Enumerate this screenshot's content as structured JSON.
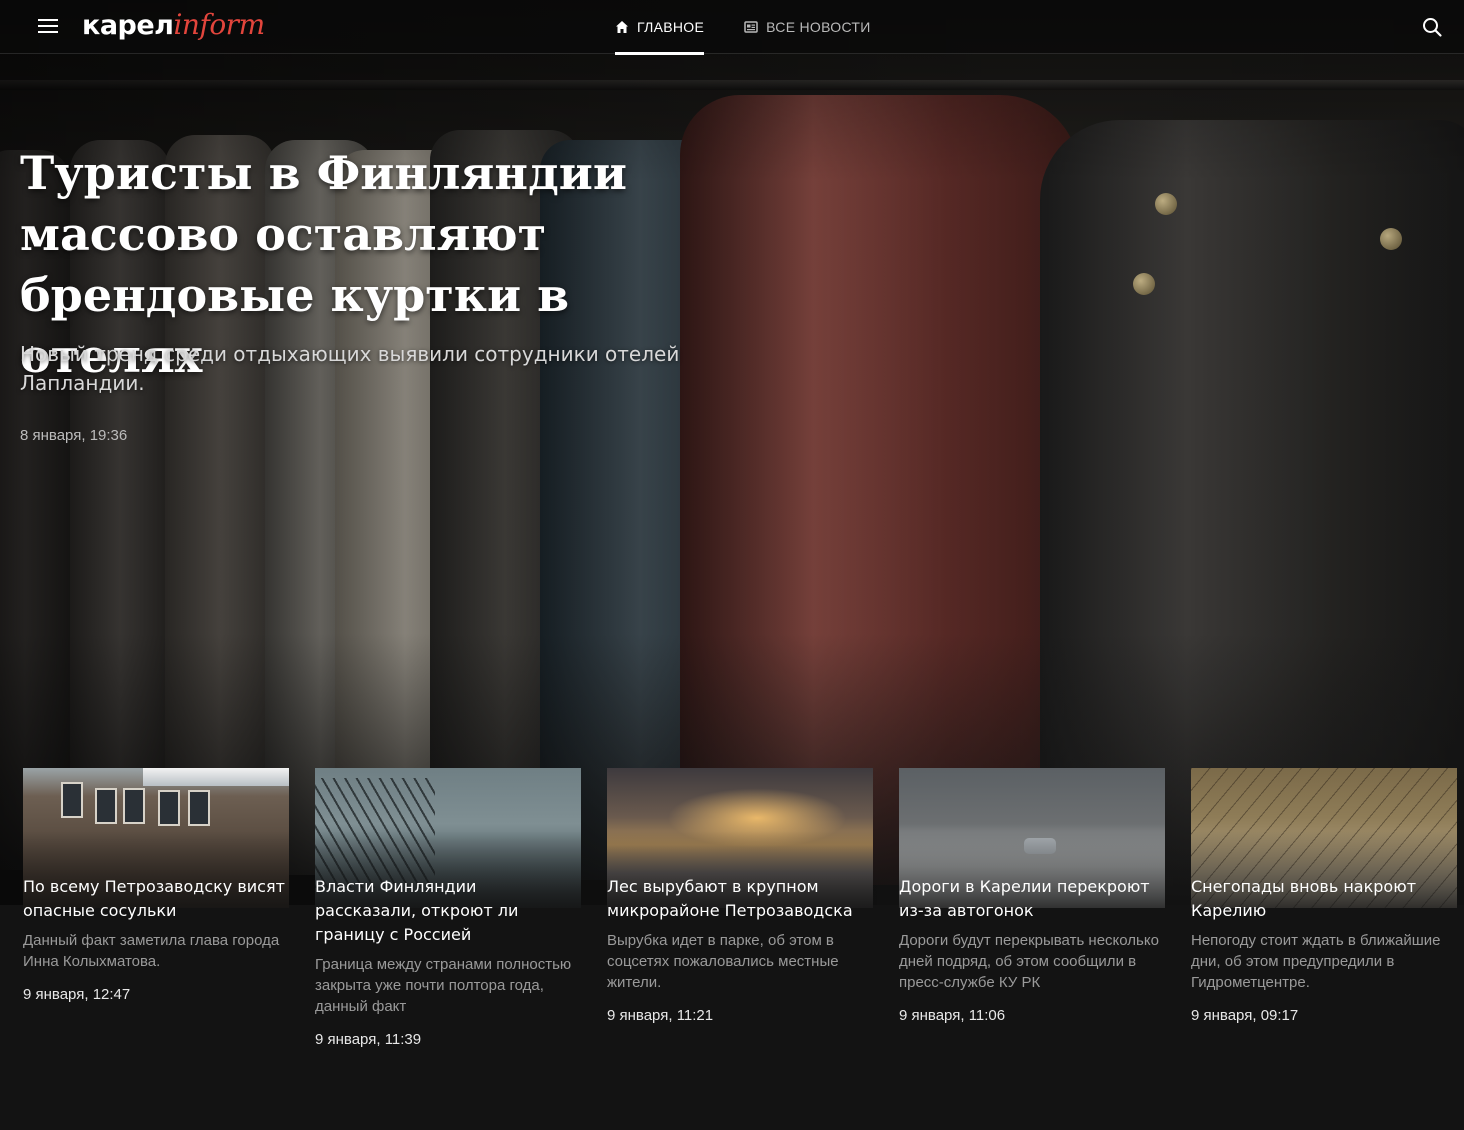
{
  "header": {
    "logo_part1": "карел",
    "logo_part2": "inform",
    "nav": [
      {
        "label": "ГЛАВНОЕ",
        "icon": "home-icon",
        "active": true
      },
      {
        "label": "ВСЕ НОВОСТИ",
        "icon": "newspaper-icon",
        "active": false
      }
    ],
    "menu_icon": "hamburger-menu-icon",
    "search_icon": "search-icon"
  },
  "hero": {
    "title": "Туристы в Финляндии массово оставляют брендовые куртки в отелях",
    "lead": "Новый тренд среди отдыхающих выявили сотрудники отелей Лапландии.",
    "date": "8 января, 19:36"
  },
  "cards": [
    {
      "title": "По всему Петрозаводску висят опасные сосульки",
      "lead": "Данный факт заметила глава города Инна Колыхматова.",
      "date": "9 января, 12:47"
    },
    {
      "title": "Власти Финляндии рассказали, откроют ли границу с Россией",
      "lead": "Граница между странами полностью закрыта уже почти полтора года, данный факт",
      "date": "9 января, 11:39"
    },
    {
      "title": "Лес вырубают в крупном микрорайоне Петрозаводска",
      "lead": "Вырубка идет в парке, об этом в соцсетях пожаловались местные жители.",
      "date": "9 января, 11:21"
    },
    {
      "title": "Дороги в Карелии перекроют из-за автогонок",
      "lead": "Дороги будут перекрывать несколько дней подряд, об этом сообщили в пресс-службе КУ РК",
      "date": "9 января, 11:06"
    },
    {
      "title": "Снегопады вновь накроют Карелию",
      "lead": "Непогоду стоит ждать в ближайшие дни, об этом предупредили в Гидрометцентре.",
      "date": "9 января, 09:17"
    }
  ],
  "colors": {
    "background": "#131313",
    "logo_accent": "#e2453c",
    "text_primary": "#ffffff",
    "text_muted": "#9a9a9a"
  }
}
